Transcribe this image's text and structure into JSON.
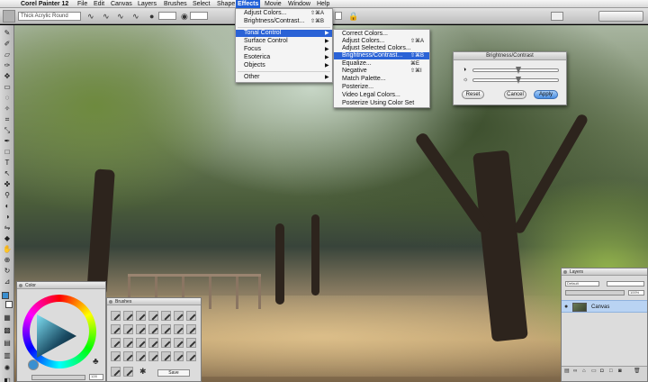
{
  "app": {
    "apple_symbol": "",
    "name": "Corel Painter 12"
  },
  "menubar": {
    "items": [
      "File",
      "Edit",
      "Canvas",
      "Layers",
      "Brushes",
      "Select",
      "Shape",
      "Effects",
      "Movie",
      "Window",
      "Help"
    ],
    "active": "Effects"
  },
  "property_bar": {
    "brush_name": "Thick Acrylic Round"
  },
  "effects_menu": {
    "items": [
      {
        "label": "Adjust Colors...",
        "shortcut": "⇧⌘A"
      },
      {
        "label": "Brightness/Contrast...",
        "shortcut": "⇧⌘B"
      },
      {
        "label": "Tonal Control",
        "submenu": true
      },
      {
        "label": "Surface Control",
        "submenu": true
      },
      {
        "label": "Focus",
        "submenu": true
      },
      {
        "label": "Esoterica",
        "submenu": true
      },
      {
        "label": "Objects",
        "submenu": true
      },
      {
        "label": "Other",
        "submenu": true
      }
    ],
    "highlighted": "Tonal Control"
  },
  "tonal_submenu": {
    "items": [
      {
        "label": "Correct Colors...",
        "shortcut": ""
      },
      {
        "label": "Adjust Colors...",
        "shortcut": "⇧⌘A"
      },
      {
        "label": "Adjust Selected Colors...",
        "shortcut": ""
      },
      {
        "label": "Brightness/Contrast...",
        "shortcut": "⇧⌘B"
      },
      {
        "label": "Equalize...",
        "shortcut": "⌘E"
      },
      {
        "label": "Negative",
        "shortcut": "⇧⌘I"
      },
      {
        "label": "Match Palette...",
        "shortcut": ""
      },
      {
        "label": "Posterize...",
        "shortcut": ""
      },
      {
        "label": "Video Legal Colors...",
        "shortcut": ""
      },
      {
        "label": "Posterize Using Color Set",
        "shortcut": ""
      }
    ],
    "highlighted": "Brightness/Contrast..."
  },
  "bc_dialog": {
    "title": "Brightness/Contrast",
    "contrast_icon": "◑",
    "brightness_icon": "☼",
    "contrast_level": 0.5,
    "brightness_level": 0.5,
    "reset": "Reset",
    "cancel": "Cancel",
    "apply": "Apply"
  },
  "color_panel": {
    "title": "Color",
    "value": "128"
  },
  "brush_panel": {
    "title": "Brushes",
    "save": "Save"
  },
  "layers_panel": {
    "title": "Layers",
    "composite": "Default",
    "opacity": "100%",
    "canvas_layer": "Canvas"
  },
  "colors": {
    "accent": "#2a62d6",
    "menubar": "#e6e6e6"
  }
}
